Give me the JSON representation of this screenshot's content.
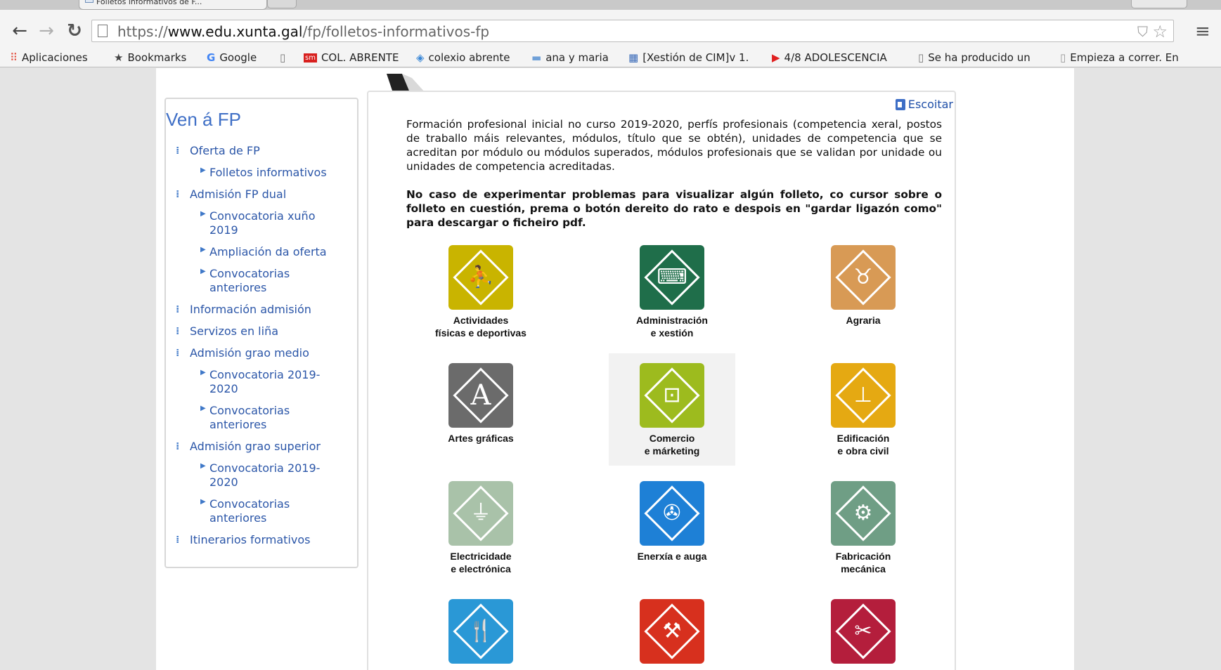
{
  "browser": {
    "tab_title": "Folletos informativos de F...",
    "url_scheme": "https://",
    "url_host": "www.edu.xunta.gal",
    "url_path": "/fp/folletos-informativos-fp"
  },
  "bookmarks": [
    {
      "label": "Aplicaciones",
      "icon": "apps-grid-icon"
    },
    {
      "label": "Bookmarks",
      "icon": "star-icon"
    },
    {
      "label": "Google",
      "icon": "google-icon"
    },
    {
      "label": "",
      "icon": "page-icon"
    },
    {
      "label": "COL. ABRENTE",
      "icon": "sm-icon"
    },
    {
      "label": "colexio abrente",
      "icon": "diamond-icon"
    },
    {
      "label": "ana y maria",
      "icon": "folder-icon"
    },
    {
      "label": "[Xestión de CIM]v 1.",
      "icon": "grid-icon"
    },
    {
      "label": "4/8 ADOLESCENCIA",
      "icon": "youtube-icon"
    },
    {
      "label": "Se ha producido un",
      "icon": "page-icon"
    },
    {
      "label": "Empieza a correr. En",
      "icon": "n-icon"
    }
  ],
  "sidebar": {
    "title": "Ven á FP",
    "items": [
      {
        "label": "Oferta de FP",
        "level": 1
      },
      {
        "label": "Folletos informativos",
        "level": 2
      },
      {
        "label": "Admisión FP dual",
        "level": 1
      },
      {
        "label": "Convocatoria xuño 2019",
        "level": 2
      },
      {
        "label": "Ampliación da oferta",
        "level": 2
      },
      {
        "label": "Convocatorias anteriores",
        "level": 2
      },
      {
        "label": "Información admisión",
        "level": 1
      },
      {
        "label": "Servizos en liña",
        "level": 1
      },
      {
        "label": "Admisión grao medio",
        "level": 1
      },
      {
        "label": "Convocatoria 2019-2020",
        "level": 2
      },
      {
        "label": "Convocatorias anteriores",
        "level": 2
      },
      {
        "label": "Admisión grao superior",
        "level": 1
      },
      {
        "label": "Convocatoria 2019-2020",
        "level": 2
      },
      {
        "label": "Convocatorias anteriores",
        "level": 2
      },
      {
        "label": "Itinerarios formativos",
        "level": 1
      }
    ]
  },
  "content": {
    "listen_label": "Escoitar",
    "intro": "Formación profesional inicial no curso 2019-2020, perfís profesionais (competencia xeral, postos de traballo máis relevantes, módulos, título que se obtén), unidades de competencia que se acreditan por módulo ou módulos superados, módulos profesionais que se validan por unidade ou unidades de competencia acreditadas.",
    "warning": "No caso de experimentar problemas para visualizar algún folleto, co cursor sobre o folleto en cuestión, prema o botón dereito do rato e despois en \"gardar ligazón como\" para descargar o ficheiro pdf."
  },
  "families": [
    {
      "line1": "Actividades",
      "line2": "físicas e deportivas",
      "color": "#c9b400",
      "icon": "sport-icon"
    },
    {
      "line1": "Administración",
      "line2": "e xestión",
      "color": "#1f6e4a",
      "icon": "office-icon"
    },
    {
      "line1": "Agraria",
      "line2": "",
      "color": "#d89a55",
      "icon": "cow-icon"
    },
    {
      "line1": "Artes gráficas",
      "line2": "",
      "color": "#6b6b6b",
      "icon": "letter-a-icon"
    },
    {
      "line1": "Comercio",
      "line2": "e márketing",
      "color": "#9dbb1e",
      "icon": "shopping-bag-icon"
    },
    {
      "line1": "Edificación",
      "line2": "e obra civil",
      "color": "#e5a912",
      "icon": "crane-icon"
    },
    {
      "line1": "Electricidade",
      "line2": "e electrónica",
      "color": "#a9c2a9",
      "icon": "plug-icon"
    },
    {
      "line1": "Enerxía e auga",
      "line2": "",
      "color": "#1e80d6",
      "icon": "wind-turbine-icon"
    },
    {
      "line1": "Fabricación",
      "line2": "mecánica",
      "color": "#6f9e85",
      "icon": "gears-icon"
    },
    {
      "line1": "",
      "line2": "",
      "color": "#2a98d6",
      "icon": "cutlery-icon"
    },
    {
      "line1": "",
      "line2": "",
      "color": "#d7301e",
      "icon": "tools-icon"
    },
    {
      "line1": "",
      "line2": "",
      "color": "#b41e3c",
      "icon": "comb-icon"
    }
  ]
}
